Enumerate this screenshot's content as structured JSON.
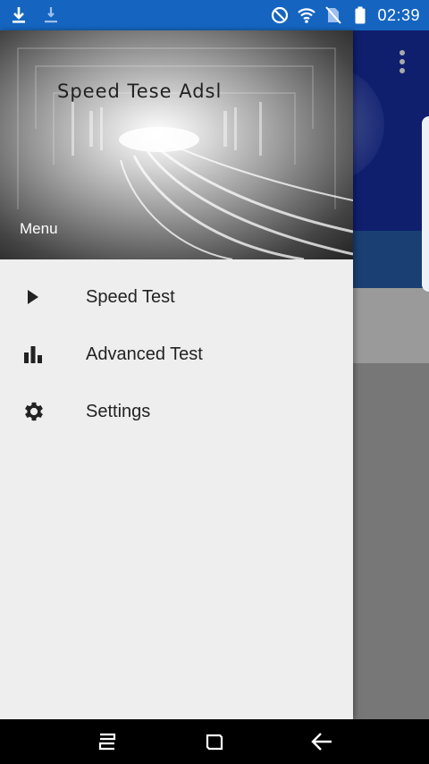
{
  "status_bar": {
    "time": "02:39",
    "icons": [
      "download-icon",
      "download-pending-icon",
      "do-not-disturb-icon",
      "wifi-icon",
      "no-sim-icon",
      "battery-icon"
    ]
  },
  "drawer": {
    "header_title": "Speed Tese Adsl",
    "header_label": "Menu",
    "items": [
      {
        "label": "Speed Test",
        "icon": "play-icon"
      },
      {
        "label": "Advanced Test",
        "icon": "bar-chart-icon"
      },
      {
        "label": "Settings",
        "icon": "gear-icon"
      }
    ]
  },
  "colors": {
    "status_bar": "#1565c0",
    "drawer_bg": "#eeeeee",
    "app_toolbar": "#0f1f6e",
    "scrim": "#777777"
  },
  "nav_bar": {
    "buttons": [
      "recent-apps-icon",
      "home-icon",
      "back-icon"
    ]
  }
}
